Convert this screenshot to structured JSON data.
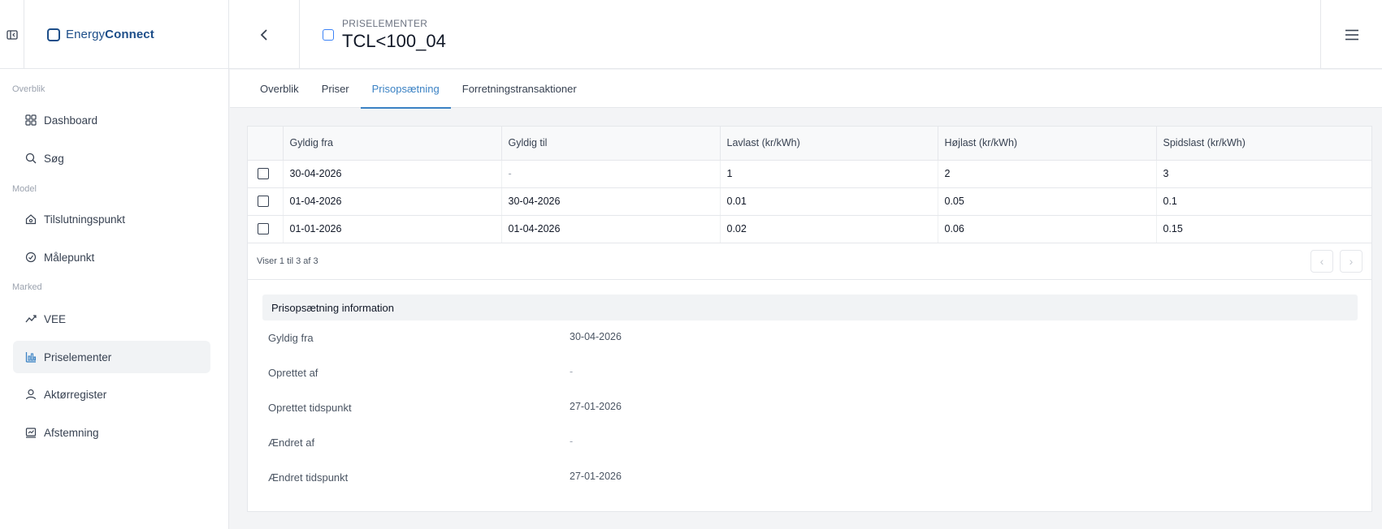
{
  "app": {
    "logo_part1": "Energy",
    "logo_part2": "Connect"
  },
  "header": {
    "eyebrow": "PRISELEMENTER",
    "title": "TCL<100_04"
  },
  "sidebar": {
    "sections": {
      "overview": "Overblik",
      "model": "Model",
      "market": "Marked"
    },
    "items": [
      {
        "label": "Dashboard",
        "icon": "grid-icon"
      },
      {
        "label": "Søg",
        "icon": "search-icon"
      },
      {
        "label": "Tilslutningspunkt",
        "icon": "house-icon"
      },
      {
        "label": "Målepunkt",
        "icon": "gauge-icon"
      },
      {
        "label": "VEE",
        "icon": "trend-icon"
      },
      {
        "label": "Priselementer",
        "icon": "chart-icon"
      },
      {
        "label": "Aktørregister",
        "icon": "user-icon"
      },
      {
        "label": "Afstemning",
        "icon": "check-chart-icon"
      }
    ]
  },
  "tabs": [
    "Overblik",
    "Priser",
    "Prisopsætning",
    "Forretningstransaktioner"
  ],
  "table": {
    "columns": [
      "Gyldig fra",
      "Gyldig til",
      "Lavlast (kr/kWh)",
      "Højlast (kr/kWh)",
      "Spidslast (kr/kWh)"
    ],
    "rows": [
      [
        "30-04-2026",
        "-",
        "1",
        "2",
        "3"
      ],
      [
        "01-04-2026",
        "30-04-2026",
        "0.01",
        "0.05",
        "0.1"
      ],
      [
        "01-01-2026",
        "01-04-2026",
        "0.02",
        "0.06",
        "0.15"
      ]
    ],
    "footer": "Viser 1 til 3 af 3"
  },
  "info": {
    "title": "Prisopsætning information",
    "fields": [
      {
        "label": "Gyldig fra",
        "value": "30-04-2026"
      },
      {
        "label": "Oprettet af",
        "value": "-"
      },
      {
        "label": "Oprettet tidspunkt",
        "value": "27-01-2026"
      },
      {
        "label": "Ændret af",
        "value": "-"
      },
      {
        "label": "Ændret tidspunkt",
        "value": "27-01-2026"
      }
    ]
  },
  "colors": {
    "brand": "#1d4e89",
    "accent": "#3b82c4"
  }
}
